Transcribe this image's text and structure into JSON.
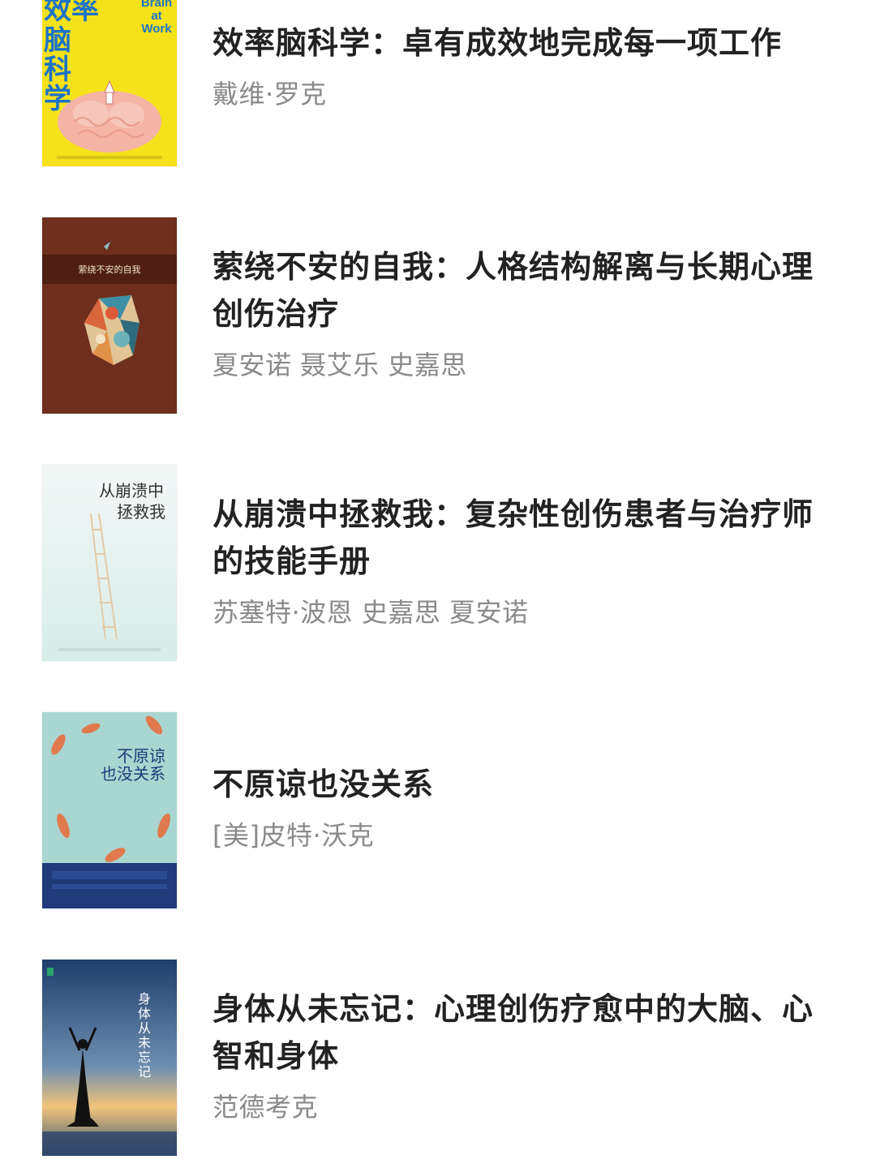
{
  "books": [
    {
      "title": "效率脑科学：卓有成效地完成每一项工作",
      "author": "戴维·罗克",
      "cover": {
        "big_text_1": "效率",
        "big_text_2": "脑科学",
        "en_text": "Brain at Work",
        "bg": "#f6e21b"
      }
    },
    {
      "title": "萦绕不安的自我：人格结构解离与长期心理创伤治疗",
      "author": "夏安诺 聂艾乐 史嘉思",
      "cover": {
        "label": "萦绕不安的自我",
        "bg": "#6e2f1e"
      }
    },
    {
      "title": "从崩溃中拯救我：复杂性创伤患者与治疗师的技能手册",
      "author": "苏塞特·波恩 史嘉思 夏安诺",
      "cover": {
        "line1": "从崩溃中",
        "line2": "拯救我",
        "bg": "#eaf3f2"
      }
    },
    {
      "title": "不原谅也没关系",
      "author": "[美]皮特·沃克",
      "cover": {
        "line1": "不原谅",
        "line2": "也没关系",
        "bg": "#a9d6d1"
      }
    },
    {
      "title": "身体从未忘记：心理创伤疗愈中的大脑、心智和身体",
      "author": "范德考克",
      "cover": {
        "label": "身体从未忘记",
        "bg": "#2f4f78"
      }
    }
  ]
}
